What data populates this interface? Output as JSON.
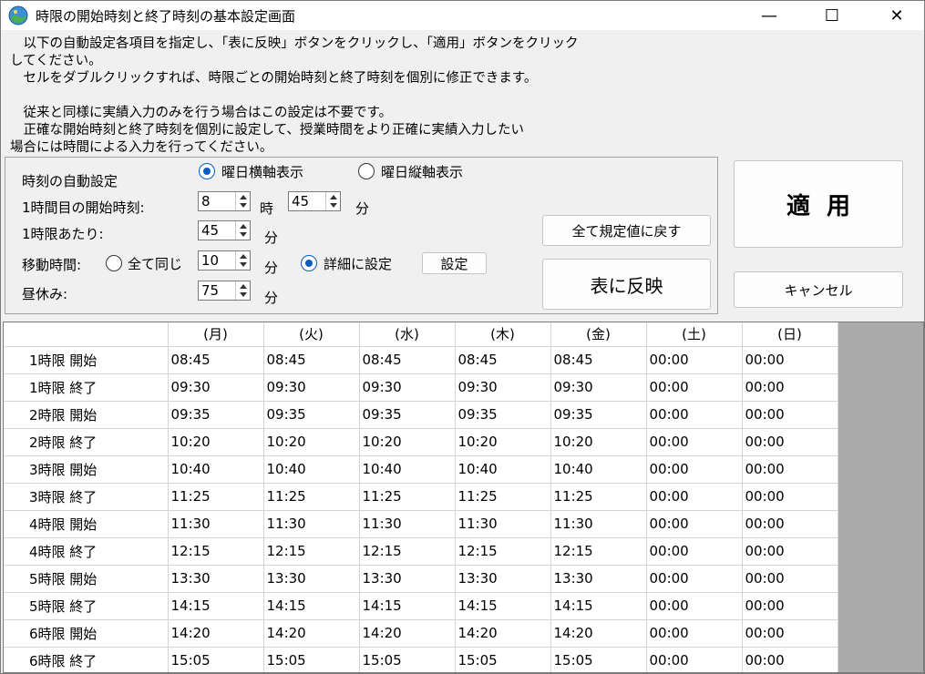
{
  "window": {
    "title": "時限の開始時刻と終了時刻の基本設定画面",
    "controls": {
      "minimize": "—",
      "maximize": "☐",
      "close": "✕"
    }
  },
  "instructions": {
    "lines": [
      "　以下の自動設定各項目を指定し、「表に反映」ボタンをクリックし、「適用」ボタンをクリック",
      "してください。",
      "　セルをダブルクリックすれば、時限ごとの開始時刻と終了時刻を個別に修正できます。",
      "",
      "　従来と同様に実績入力のみを行う場合はこの設定は不要です。",
      "　正確な開始時刻と終了時刻を個別に設定して、授業時間をより正確に実績入力したい",
      "場合には時間による入力を行ってください。"
    ]
  },
  "settings": {
    "auto_label": "時刻の自動設定",
    "radio_horizontal": "曜日横軸表示",
    "radio_vertical": "曜日縦軸表示",
    "first_start_label": "1時間目の開始時刻:",
    "first_start_hour": "8",
    "hour_unit": "時",
    "first_start_minute": "45",
    "minute_unit": "分",
    "per_period_label": "1時限あたり:",
    "per_period_value": "45",
    "move_label": "移動時間:",
    "move_same_label": "全て同じ",
    "move_value": "10",
    "move_detail_label": "詳細に設定",
    "move_detail_button": "設定",
    "lunch_label": "昼休み:",
    "lunch_value": "75"
  },
  "buttons": {
    "reset": "全て規定値に戻す",
    "reflect": "表に反映",
    "apply": "適用",
    "cancel": "キャンセル"
  },
  "table": {
    "headers": [
      "",
      "(月)",
      "(火)",
      "(水)",
      "(木)",
      "(金)",
      "(土)",
      "(日)"
    ],
    "rows": [
      [
        "1時限 開始",
        "08:45",
        "08:45",
        "08:45",
        "08:45",
        "08:45",
        "00:00",
        "00:00"
      ],
      [
        "1時限 終了",
        "09:30",
        "09:30",
        "09:30",
        "09:30",
        "09:30",
        "00:00",
        "00:00"
      ],
      [
        "2時限 開始",
        "09:35",
        "09:35",
        "09:35",
        "09:35",
        "09:35",
        "00:00",
        "00:00"
      ],
      [
        "2時限 終了",
        "10:20",
        "10:20",
        "10:20",
        "10:20",
        "10:20",
        "00:00",
        "00:00"
      ],
      [
        "3時限 開始",
        "10:40",
        "10:40",
        "10:40",
        "10:40",
        "10:40",
        "00:00",
        "00:00"
      ],
      [
        "3時限 終了",
        "11:25",
        "11:25",
        "11:25",
        "11:25",
        "11:25",
        "00:00",
        "00:00"
      ],
      [
        "4時限 開始",
        "11:30",
        "11:30",
        "11:30",
        "11:30",
        "11:30",
        "00:00",
        "00:00"
      ],
      [
        "4時限 終了",
        "12:15",
        "12:15",
        "12:15",
        "12:15",
        "12:15",
        "00:00",
        "00:00"
      ],
      [
        "5時限 開始",
        "13:30",
        "13:30",
        "13:30",
        "13:30",
        "13:30",
        "00:00",
        "00:00"
      ],
      [
        "5時限 終了",
        "14:15",
        "14:15",
        "14:15",
        "14:15",
        "14:15",
        "00:00",
        "00:00"
      ],
      [
        "6時限 開始",
        "14:20",
        "14:20",
        "14:20",
        "14:20",
        "14:20",
        "00:00",
        "00:00"
      ],
      [
        "6時限 終了",
        "15:05",
        "15:05",
        "15:05",
        "15:05",
        "15:05",
        "00:00",
        "00:00"
      ]
    ]
  }
}
